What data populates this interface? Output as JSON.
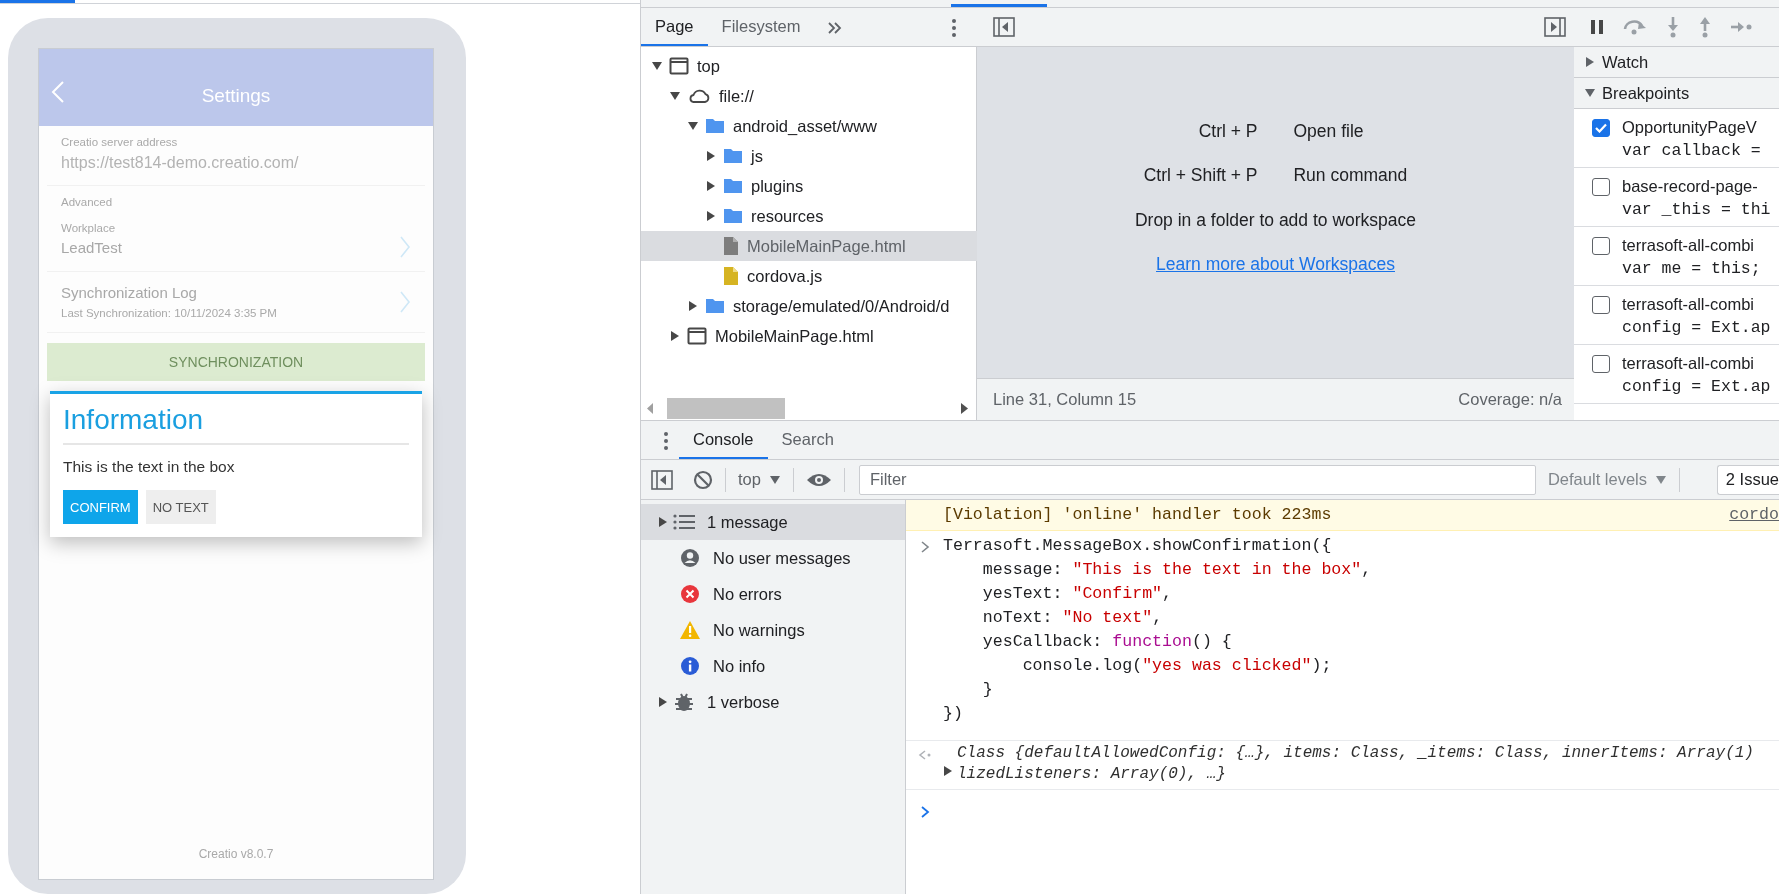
{
  "phone": {
    "header": {
      "title": "Settings"
    },
    "server": {
      "label": "Creatio server address",
      "value": "https://test814-demo.creatio.com/"
    },
    "workplace": {
      "section": "Advanced",
      "label": "Workplace",
      "value": "LeadTest"
    },
    "sync_log": {
      "title": "Synchronization Log",
      "subtitle": "Last Synchronization: 10/11/2024 3:35 PM"
    },
    "sync_button": "SYNCHRONIZATION",
    "dialog": {
      "title": "Information",
      "message": "This is the text in the box",
      "buttons": [
        {
          "label": "CONFIRM",
          "kind": "primary"
        },
        {
          "label": "NO TEXT",
          "kind": "secondary"
        }
      ]
    },
    "version": "Creatio v8.0.7"
  },
  "sources": {
    "tabs": [
      {
        "label": "Page",
        "selected": true
      },
      {
        "label": "Filesystem",
        "selected": false
      }
    ],
    "tree": [
      {
        "label": "top",
        "kind": "frame",
        "expanded": true,
        "selected": false,
        "children": [
          {
            "label": "file://",
            "kind": "cloud",
            "expanded": true,
            "selected": false,
            "children": [
              {
                "label": "android_asset/www",
                "kind": "folder",
                "expanded": true,
                "selected": false,
                "children": [
                  {
                    "label": "js",
                    "kind": "folder",
                    "expanded": false,
                    "selected": false
                  },
                  {
                    "label": "plugins",
                    "kind": "folder",
                    "expanded": false,
                    "selected": false
                  },
                  {
                    "label": "resources",
                    "kind": "folder",
                    "expanded": false,
                    "selected": false
                  },
                  {
                    "label": "MobileMainPage.html",
                    "kind": "file",
                    "selected": true
                  },
                  {
                    "label": "cordova.js",
                    "kind": "script",
                    "selected": false
                  }
                ]
              },
              {
                "label": "storage/emulated/0/Android/d",
                "kind": "folder",
                "expanded": false,
                "selected": false
              }
            ]
          },
          {
            "label": "MobileMainPage.html",
            "kind": "frame",
            "expanded": false,
            "selected": false
          }
        ]
      }
    ]
  },
  "editor": {
    "shortcuts": [
      {
        "keys": "Ctrl + P",
        "action": "Open file"
      },
      {
        "keys": "Ctrl + Shift + P",
        "action": "Run command"
      }
    ],
    "hint": "Drop in a folder to add to workspace",
    "link": "Learn more about Workspaces",
    "status": {
      "position": "Line 31, Column 15",
      "coverage": "Coverage: n/a"
    }
  },
  "debugger": {
    "sections": [
      {
        "title": "Watch",
        "expanded": false
      },
      {
        "title": "Breakpoints",
        "expanded": true
      }
    ],
    "breakpoints": [
      {
        "file": "OpportunityPageV",
        "code": "var callback =",
        "checked": true
      },
      {
        "file": "base-record-page-",
        "code": "var _this = thi",
        "checked": false
      },
      {
        "file": "terrasoft-all-combi",
        "code": "var me = this;",
        "checked": false
      },
      {
        "file": "terrasoft-all-combi",
        "code": "config = Ext.ap",
        "checked": false
      },
      {
        "file": "terrasoft-all-combi",
        "code": "config = Ext.ap",
        "checked": false
      }
    ]
  },
  "console": {
    "tabs": [
      {
        "label": "Console",
        "selected": true
      },
      {
        "label": "Search",
        "selected": false
      }
    ],
    "context": "top",
    "filter": {
      "placeholder": "Filter"
    },
    "levels": "Default levels",
    "issues": "2 Issue",
    "sidebar": [
      {
        "label": "1 message",
        "kind": "messages",
        "expandable": true,
        "selected": true
      },
      {
        "label": "No user messages",
        "kind": "user",
        "expandable": false,
        "selected": false
      },
      {
        "label": "No errors",
        "kind": "error",
        "expandable": false,
        "selected": false
      },
      {
        "label": "No warnings",
        "kind": "warning",
        "expandable": false,
        "selected": false
      },
      {
        "label": "No info",
        "kind": "info",
        "expandable": false,
        "selected": false
      },
      {
        "label": "1 verbose",
        "kind": "verbose",
        "expandable": true,
        "selected": false
      }
    ],
    "messages": [
      {
        "kind": "violation",
        "text": "[Violation] 'online' handler took 223ms",
        "source": "cordo"
      },
      {
        "kind": "input",
        "lines": [
          {
            "tokens": [
              {
                "kind": "plain",
                "text": "Terrasoft.MessageBox.showConfirmation({"
              }
            ],
            "children": [
              {
                "tokens": [
                  {
                    "kind": "plain",
                    "text": "message: "
                  },
                  {
                    "kind": "string",
                    "text": "\"This is the text in the box\""
                  },
                  {
                    "kind": "plain",
                    "text": ","
                  }
                ]
              },
              {
                "tokens": [
                  {
                    "kind": "plain",
                    "text": "yesText: "
                  },
                  {
                    "kind": "string",
                    "text": "\"Confirm\""
                  },
                  {
                    "kind": "plain",
                    "text": ","
                  }
                ]
              },
              {
                "tokens": [
                  {
                    "kind": "plain",
                    "text": "noText: "
                  },
                  {
                    "kind": "string",
                    "text": "\"No text\""
                  },
                  {
                    "kind": "plain",
                    "text": ","
                  }
                ]
              },
              {
                "tokens": [
                  {
                    "kind": "plain",
                    "text": "yesCallback: "
                  },
                  {
                    "kind": "keyword",
                    "text": "function"
                  },
                  {
                    "kind": "plain",
                    "text": "() {"
                  }
                ],
                "children": [
                  {
                    "tokens": [
                      {
                        "kind": "plain",
                        "text": "console.log("
                      },
                      {
                        "kind": "string",
                        "text": "\"yes was clicked\""
                      },
                      {
                        "kind": "plain",
                        "text": ");"
                      }
                    ]
                  }
                ]
              },
              {
                "tokens": [
                  {
                    "kind": "plain",
                    "text": "}"
                  }
                ]
              }
            ]
          },
          {
            "tokens": [
              {
                "kind": "plain",
                "text": "})"
              }
            ]
          }
        ]
      },
      {
        "kind": "result",
        "lines": [
          "Class {defaultAllowedConfig: {…}, items: Class, _items: Class, innerItems: Array(1)",
          "lizedListeners: Array(0), …}"
        ]
      },
      {
        "kind": "prompt"
      }
    ]
  }
}
